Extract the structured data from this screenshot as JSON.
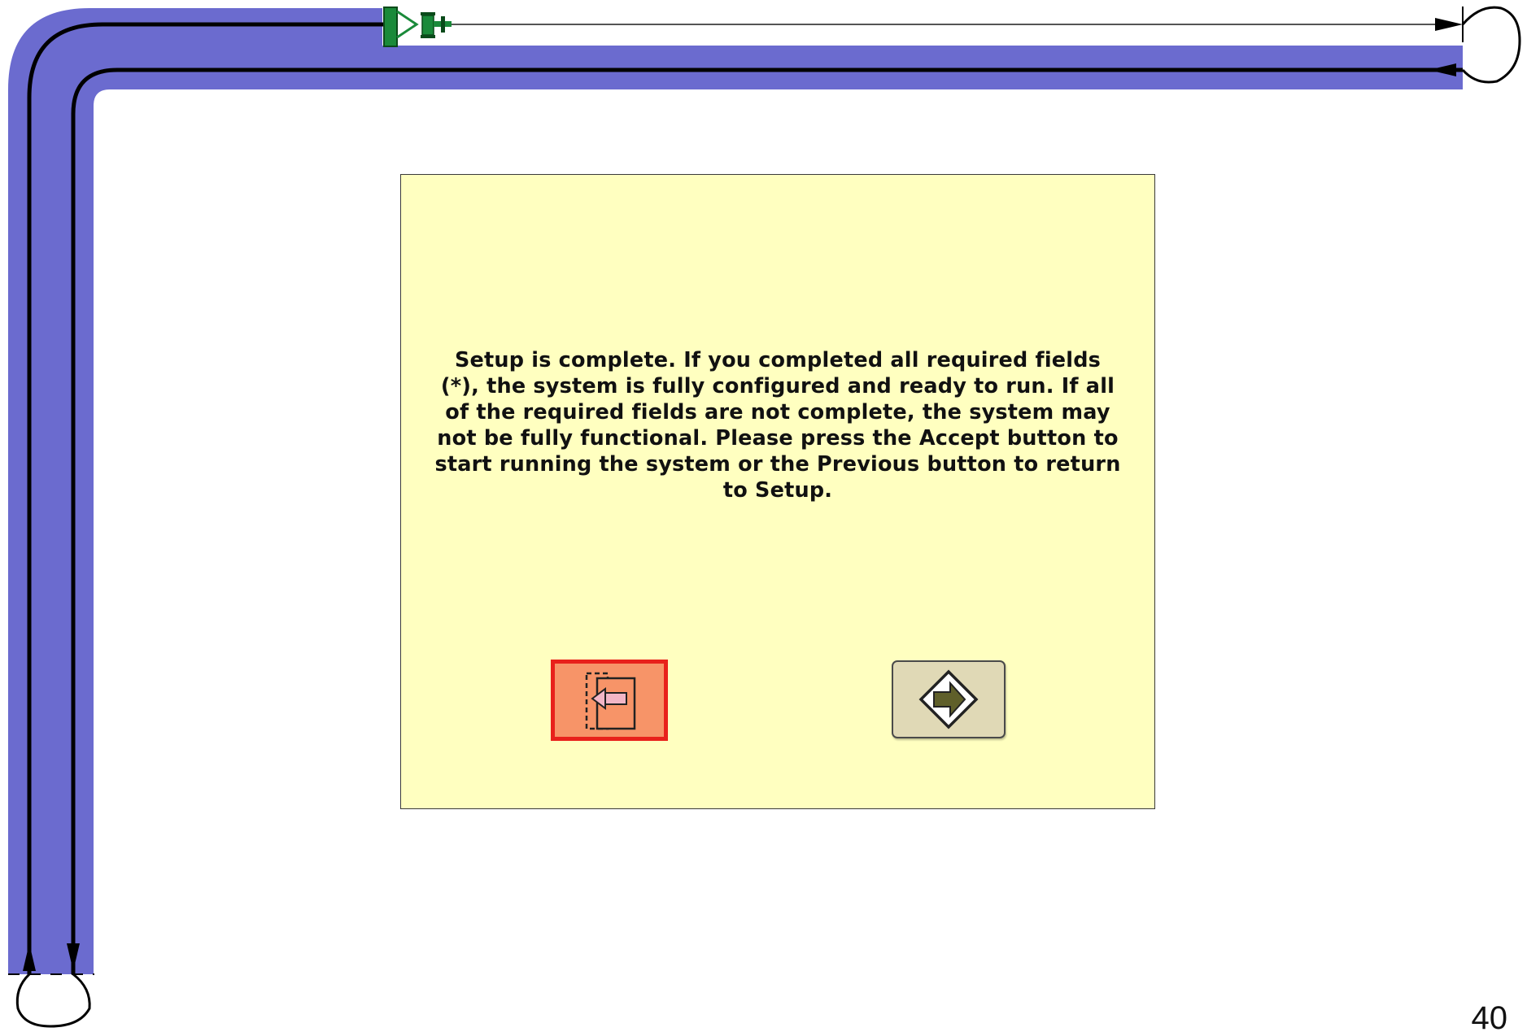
{
  "dialog": {
    "message": "Setup is complete.  If you completed all required fields (*), the system is fully configured and ready to run.  If all of the required fields are not complete, the system may not be fully functional.  Please press the Accept button to start running the system or the Previous button to return to Setup.",
    "previous_button_icon": "previous-page-icon",
    "accept_button_icon": "accept-arrow-icon"
  },
  "guidance_path": {
    "path_color": "#6b6bcf",
    "line_color": "#000000",
    "vehicle_color": "#1a8a3a",
    "vehicle_icon": "tractor-icon"
  },
  "footer": {
    "page_number": "40"
  }
}
